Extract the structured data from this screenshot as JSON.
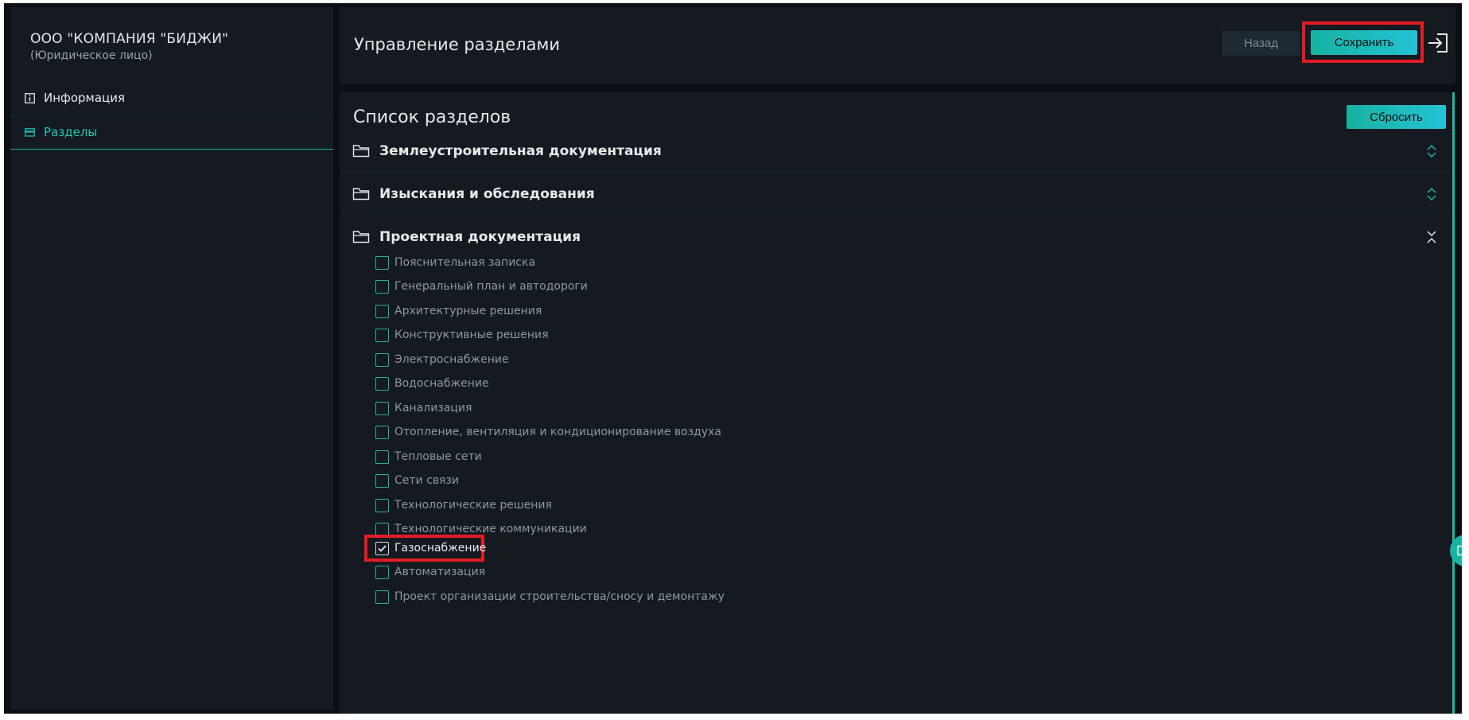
{
  "sidebar": {
    "company_name": "ООО \"КОМПАНИЯ \"БИДЖИ\"",
    "company_type": "(Юридическое лицо)",
    "items": [
      {
        "label": "Информация",
        "icon": "info-icon",
        "active": false
      },
      {
        "label": "Разделы",
        "icon": "sections-icon",
        "active": true
      }
    ]
  },
  "header": {
    "title": "Управление разделами",
    "back_label": "Назад",
    "save_label": "Сохранить",
    "logout_icon": "logout-icon"
  },
  "content": {
    "title": "Список разделов",
    "reset_label": "Сбросить",
    "groups": [
      {
        "label": "Землеустроительная документация",
        "expanded": false
      },
      {
        "label": "Изыскания и обследования",
        "expanded": false
      },
      {
        "label": "Проектная документация",
        "expanded": true
      }
    ],
    "items": [
      {
        "label": "Пояснительная записка",
        "checked": false
      },
      {
        "label": "Генеральный план и автодороги",
        "checked": false
      },
      {
        "label": "Архитектурные решения",
        "checked": false
      },
      {
        "label": "Конструктивные решения",
        "checked": false
      },
      {
        "label": "Электроснабжение",
        "checked": false
      },
      {
        "label": "Водоснабжение",
        "checked": false
      },
      {
        "label": "Канализация",
        "checked": false
      },
      {
        "label": "Отопление, вентиляция и кондиционирование воздуха",
        "checked": false
      },
      {
        "label": "Тепловые сети",
        "checked": false
      },
      {
        "label": "Сети связи",
        "checked": false
      },
      {
        "label": "Технологические решения",
        "checked": false
      },
      {
        "label": "Технологические коммуникации",
        "checked": false
      },
      {
        "label": "Газоснабжение",
        "checked": true
      },
      {
        "label": "Автоматизация",
        "checked": false
      },
      {
        "label": "Проект организации строительства/сносу и демонтажу",
        "checked": false
      }
    ]
  },
  "colors": {
    "accent": "#1fb5a3",
    "highlight": "#e41b23",
    "background": "#0b0f13",
    "panel": "#141a20"
  }
}
